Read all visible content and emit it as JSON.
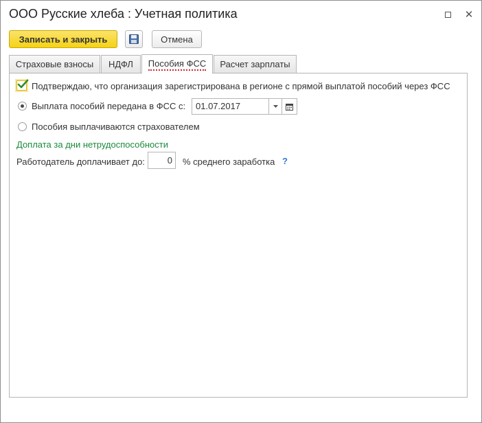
{
  "window": {
    "title": "ООО Русские хлеба : Учетная политика",
    "maximize_icon": "maximize-icon",
    "close_label": "✕"
  },
  "toolbar": {
    "save_close_label": "Записать и закрыть",
    "save_icon": "floppy-disk-icon",
    "cancel_label": "Отмена"
  },
  "tabs": [
    {
      "label": "Страховые взносы",
      "active": false
    },
    {
      "label": "НДФЛ",
      "active": false
    },
    {
      "label": "Пособия ФСС",
      "active": true
    },
    {
      "label": "Расчет зарплаты",
      "active": false
    }
  ],
  "form": {
    "confirm_checkbox": {
      "checked": true,
      "label": "Подтверждаю, что организация зарегистрирована в регионе с прямой выплатой пособий через ФСС"
    },
    "radio_fss": {
      "checked": true,
      "label": "Выплата пособий передана в ФСС с:",
      "date_value": "01.07.2017"
    },
    "radio_insurer": {
      "checked": false,
      "label": "Пособия выплачиваются страхователем"
    },
    "section_title": "Доплата за дни нетрудоспособности",
    "employer_pays_label": "Работодатель доплачивает до:",
    "employer_pays_value": "0",
    "percent_suffix": "% среднего заработка",
    "help_label": "?"
  },
  "colors": {
    "primary_button": "#f5d215",
    "section_title": "#1b8a3a",
    "active_tab_underline": "#d2222d",
    "help": "#2f7bd6"
  }
}
